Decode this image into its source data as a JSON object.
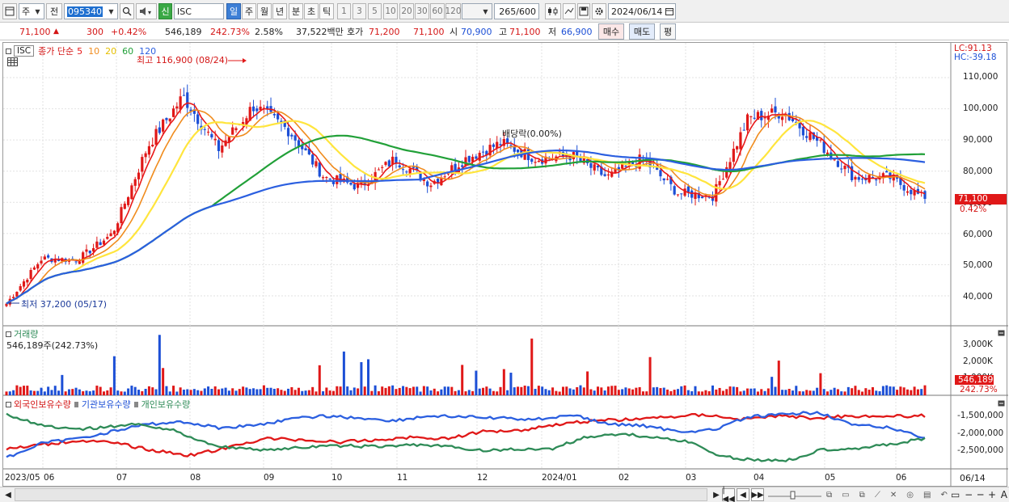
{
  "toolbar": {
    "period_select": "주",
    "prev_label": "전",
    "stock_code": "095340",
    "new_label": "신",
    "stock_name": "ISC",
    "period_tabs": [
      "일",
      "주",
      "월",
      "년",
      "분",
      "초",
      "틱"
    ],
    "interval_buttons": [
      "1",
      "3",
      "5",
      "10",
      "20",
      "30",
      "60",
      "120"
    ],
    "count_display": "265",
    "count_total": "/600",
    "date": "2024/06/14"
  },
  "quote": {
    "price": "71,100",
    "change_arrow": "▲",
    "change": "300",
    "change_pct": "+0.42%",
    "volume": "546,189",
    "volume_ratio": "242.73%",
    "turnover": "2.58%",
    "amount": "37,522백만",
    "bid_label": "호가",
    "bid": "71,200",
    "ask": "71,100",
    "open_label": "시",
    "open": "70,900",
    "high_label": "고",
    "high": "71,100",
    "low_label": "저",
    "low": "66,900",
    "buy_button": "매수",
    "sell_button": "매도",
    "eval_button": "평"
  },
  "main_panel": {
    "stock_tag": "ISC",
    "legend_prefix": "종가 단순",
    "ma_periods": [
      "5",
      "10",
      "20",
      "60",
      "120"
    ],
    "ma_colors": [
      "#e81818",
      "#f08c1e",
      "#ffe53d",
      "#21a038",
      "#2b5fe0"
    ],
    "lc_label": "LC:91.13",
    "hc_label": "HC:-39.18",
    "high_annotation": "최고 116,900 (08/24)",
    "low_annotation": "최저 37,200 (05/17)",
    "dividend_annotation": "배당락(0.00%)",
    "price_axis_ticks": [
      "110,000",
      "100,000",
      "90,000",
      "80,000",
      "70,000",
      "60,000",
      "50,000",
      "40,000"
    ],
    "last_price_tag": "71,100",
    "last_change_tag": "0.42%"
  },
  "volume_panel": {
    "title": "거래량",
    "value_label": "546,189주(242.73%)",
    "axis_ticks": [
      "3,000K",
      "2,000K",
      "1,000K"
    ],
    "last_volume_tag": "546,189",
    "last_ratio_tag": "242.73%"
  },
  "holdings_panel": {
    "legend": [
      "외국인보유수량",
      "기관보유수량",
      "개인보유수량"
    ],
    "colors": [
      "#e01818",
      "#2b5fe0",
      "#2e8b57"
    ],
    "axis_ticks": [
      "-1,500,000",
      "-2,000,000",
      "-2,500,000"
    ]
  },
  "date_axis": [
    "2023/05",
    "06",
    "07",
    "08",
    "09",
    "10",
    "11",
    "12",
    "2024/01",
    "02",
    "03",
    "04",
    "05",
    "06"
  ],
  "date_axis_end": "06/14",
  "chart_data": {
    "type": "candlestick",
    "symbol": "ISC (095340)",
    "x_range": [
      "2023/05",
      "2024/06/14"
    ],
    "ylim": [
      35000,
      118000
    ],
    "y_ticks": [
      40000,
      50000,
      60000,
      70000,
      80000,
      90000,
      100000,
      110000
    ],
    "close_path": [
      [
        "2023/05",
        37500
      ],
      [
        "2023/06",
        52000
      ],
      [
        "2023/06-late",
        51500
      ],
      [
        "2023/07-mid",
        60000
      ],
      [
        "2023/07-late",
        88000
      ],
      [
        "2023/08-early",
        104000
      ],
      [
        "2023/08-mid",
        87000
      ],
      [
        "2023/08/24",
        101000
      ],
      [
        "2023/09-early",
        93000
      ],
      [
        "2023/09-late",
        78000
      ],
      [
        "2023/10",
        75000
      ],
      [
        "2023/10-late",
        84000
      ],
      [
        "2023/11-early",
        76000
      ],
      [
        "2023/11-mid",
        84000
      ],
      [
        "2023/11-late",
        89000
      ],
      [
        "2023/12",
        84000
      ],
      [
        "2024/01",
        85000
      ],
      [
        "2024/01-late",
        78000
      ],
      [
        "2024/02",
        84000
      ],
      [
        "2024/02-mid",
        73000
      ],
      [
        "2024/03-early",
        72000
      ],
      [
        "2024/03-mid",
        97000
      ],
      [
        "2024/04",
        99000
      ],
      [
        "2024/04-late",
        89000
      ],
      [
        "2024/05",
        78000
      ],
      [
        "2024/05-late",
        78000
      ],
      [
        "2024/06/14",
        71100
      ]
    ],
    "high": {
      "value": 116900,
      "date": "08/24"
    },
    "low": {
      "value": 37200,
      "date": "05/17"
    },
    "last_close": 71100,
    "volume": {
      "last": 546189,
      "ratio_pct": 242.73,
      "axis_ticks": [
        1000000,
        2000000,
        3000000
      ]
    },
    "holdings": {
      "series": [
        "외국인보유수량",
        "기관보유수량",
        "개인보유수량"
      ],
      "axis_ticks": [
        -1500000,
        -2000000,
        -2500000
      ]
    },
    "grid": true
  }
}
